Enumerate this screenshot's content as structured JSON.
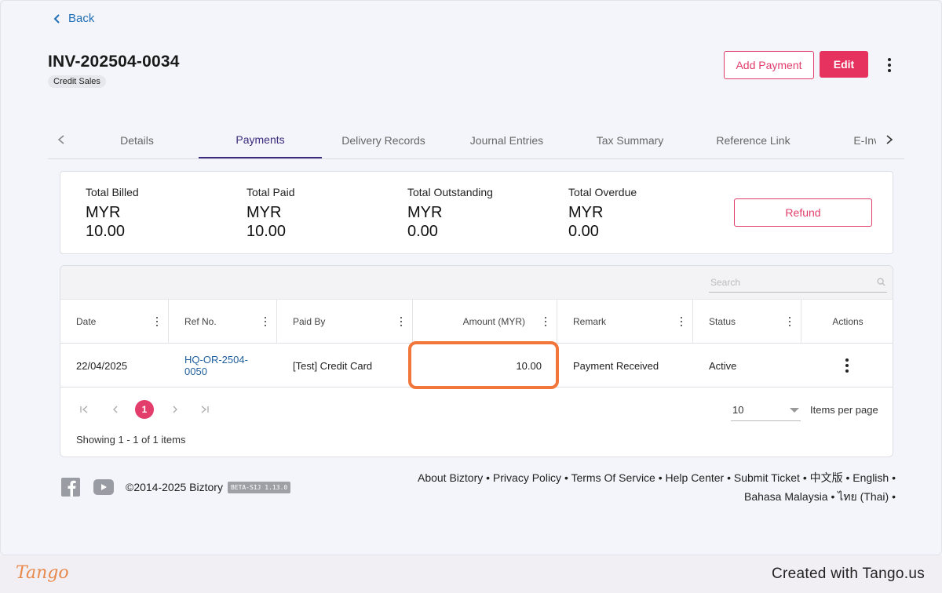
{
  "nav": {
    "back_label": "Back"
  },
  "invoice": {
    "number": "INV-202504-0034",
    "type_badge": "Credit Sales"
  },
  "actions": {
    "add_payment": "Add Payment",
    "edit": "Edit"
  },
  "tabs": [
    {
      "label": "Details",
      "active": false
    },
    {
      "label": "Payments",
      "active": true
    },
    {
      "label": "Delivery Records",
      "active": false
    },
    {
      "label": "Journal Entries",
      "active": false
    },
    {
      "label": "Tax Summary",
      "active": false
    },
    {
      "label": "Reference Link",
      "active": false
    },
    {
      "label": "E-Invoice",
      "active": false
    }
  ],
  "summary": {
    "total_billed": {
      "label": "Total Billed",
      "currency": "MYR",
      "value": "10.00"
    },
    "total_paid": {
      "label": "Total Paid",
      "currency": "MYR",
      "value": "10.00"
    },
    "total_outstanding": {
      "label": "Total Outstanding",
      "currency": "MYR",
      "value": "0.00"
    },
    "total_overdue": {
      "label": "Total Overdue",
      "currency": "MYR",
      "value": "0.00"
    },
    "refund_label": "Refund"
  },
  "grid": {
    "search_placeholder": "Search",
    "columns": [
      "Date",
      "Ref No.",
      "Paid By",
      "Amount (MYR)",
      "Remark",
      "Status",
      "Actions"
    ],
    "rows": [
      {
        "date": "22/04/2025",
        "ref_no": "HQ-OR-2504-0050",
        "paid_by": "[Test] Credit Card",
        "amount": "10.00",
        "remark": "Payment Received",
        "status": "Active"
      }
    ],
    "pager": {
      "current_page": "1",
      "items_per_page": "10",
      "items_per_page_label": "Items per page",
      "showing": "Showing 1 - 1 of 1 items"
    }
  },
  "footer": {
    "copyright": "©2014-2025 Biztory",
    "version": "BETA-SIJ 1.13.0",
    "links_line1": "About Biztory • Privacy Policy • Terms Of Service • Help Center • Submit Ticket • 中文版 • English •",
    "links_line2": "Bahasa Malaysia • ไทย (Thai) •"
  },
  "tango": {
    "logo": "Tango",
    "credit": "Created with Tango.us"
  },
  "colors": {
    "accent": "#e6325f",
    "tab_active": "#3b2a7d",
    "link": "#1f5f9e",
    "highlight": "#f2753a"
  }
}
